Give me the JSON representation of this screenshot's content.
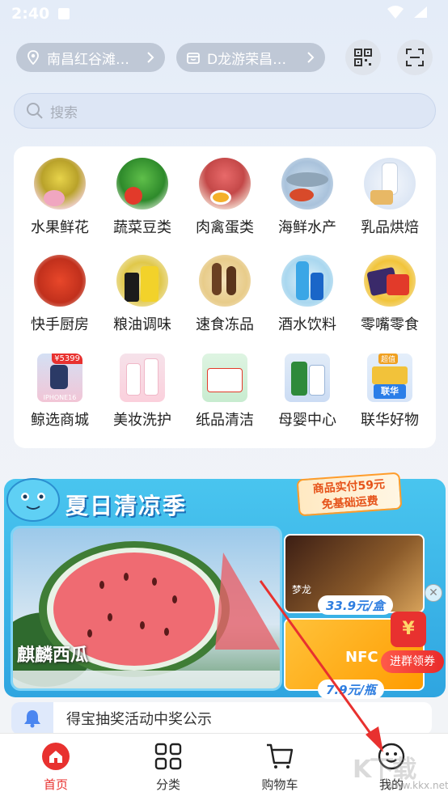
{
  "status_bar": {
    "time": "2:40"
  },
  "header": {
    "location": "南昌红谷滩…",
    "store": "D龙游荣昌…"
  },
  "search": {
    "placeholder": "搜索"
  },
  "categories": [
    {
      "label": "水果鲜花",
      "icon": "durian-icon"
    },
    {
      "label": "蔬菜豆类",
      "icon": "vegetables-icon"
    },
    {
      "label": "肉禽蛋类",
      "icon": "meat-egg-icon"
    },
    {
      "label": "海鲜水产",
      "icon": "seafood-icon"
    },
    {
      "label": "乳品烘焙",
      "icon": "milk-bread-icon"
    },
    {
      "label": "快手厨房",
      "icon": "crayfish-icon"
    },
    {
      "label": "粮油调味",
      "icon": "oil-bottle-icon"
    },
    {
      "label": "速食冻品",
      "icon": "ice-cream-icon"
    },
    {
      "label": "酒水饮料",
      "icon": "water-bottle-icon"
    },
    {
      "label": "零嘴零食",
      "icon": "snacks-icon"
    },
    {
      "label": "鲸选商城",
      "icon": "phone-icon",
      "badge": "¥5399",
      "sublabel": "IPHONE16"
    },
    {
      "label": "美妆洗护",
      "icon": "cosmetics-icon"
    },
    {
      "label": "纸品清洁",
      "icon": "tissue-icon"
    },
    {
      "label": "母婴中心",
      "icon": "baby-formula-icon"
    },
    {
      "label": "联华好物",
      "icon": "lianhua-bag-icon",
      "badge": "超值",
      "sublabel": "联华"
    }
  ],
  "banner": {
    "title": "夏日清凉季",
    "promo_line1": "商品实付59元",
    "promo_line2": "免基础运费",
    "hero_label": "麒麟西瓜",
    "product1_price": "33.9元/盒",
    "product1_brand": "梦龙",
    "product2_price": "7.9元/瓶",
    "product2_brand": "NFC",
    "red_pill": "进群领券",
    "red_pill_symbol": "¥"
  },
  "notice": {
    "text": "得宝抽奖活动中奖公示"
  },
  "tabs": [
    {
      "label": "首页",
      "active": true
    },
    {
      "label": "分类",
      "active": false
    },
    {
      "label": "购物车",
      "active": false
    },
    {
      "label": "我的",
      "active": false
    }
  ],
  "watermark": {
    "text": "K下载",
    "domain": "www.kkx.net"
  },
  "colors": {
    "accent": "#e8312f",
    "banner": "#3fb6ea",
    "arrow": "#e8312f"
  }
}
